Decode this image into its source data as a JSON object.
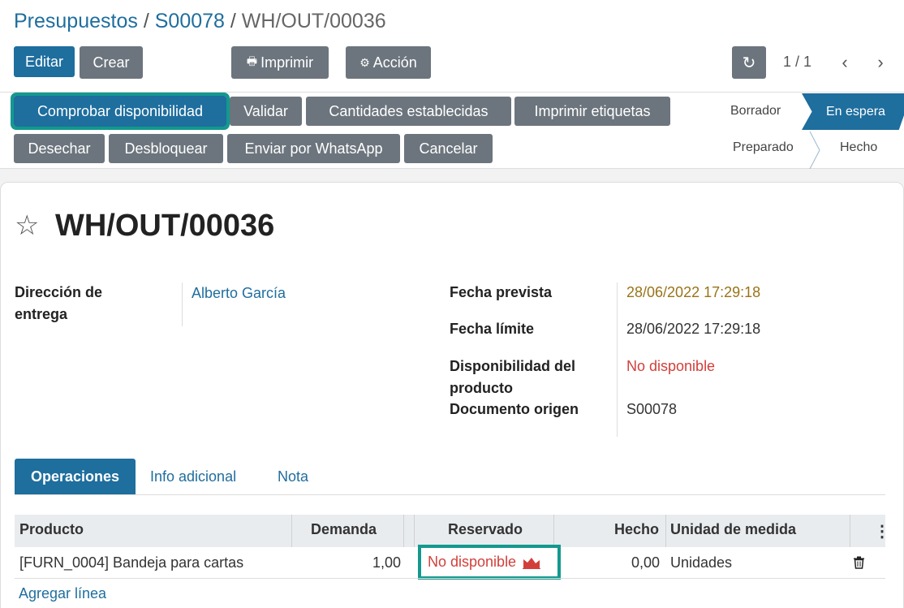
{
  "breadcrumb": {
    "crumb1": "Presupuestos",
    "sep1": "/",
    "crumb2": "S00078",
    "sep2": "/",
    "current": "WH/OUT/00036"
  },
  "toolbar": {
    "edit": "Editar",
    "create": "Crear",
    "print": "Imprimir",
    "action": "Acción"
  },
  "pager": {
    "value": "1 / 1"
  },
  "header_buttons": {
    "check_availability": "Comprobar disponibilidad",
    "validate": "Validar",
    "set_quantities": "Cantidades establecidas",
    "print_labels": "Imprimir etiquetas",
    "scrap": "Desechar",
    "unlock": "Desbloquear",
    "whatsapp": "Enviar por WhatsApp",
    "cancel": "Cancelar"
  },
  "statusbar": {
    "draft": "Borrador",
    "waiting": "En espera",
    "ready": "Preparado",
    "done": "Hecho",
    "active": "En espera"
  },
  "record": {
    "title": "WH/OUT/00036",
    "delivery_address_label_1": "Dirección de",
    "delivery_address_label_2": "entrega",
    "delivery_address": "Alberto García",
    "scheduled_date_label": "Fecha prevista",
    "scheduled_date": "28/06/2022 17:29:18",
    "deadline_label": "Fecha límite",
    "deadline": "28/06/2022 17:29:18",
    "availability_label_1": "Disponibilidad del",
    "availability_label_2": "producto",
    "availability": "No disponible",
    "origin_label": "Documento origen",
    "origin": "S00078"
  },
  "tabs": {
    "operations": "Operaciones",
    "extra_info": "Info adicional",
    "note": "Nota"
  },
  "table": {
    "headers": {
      "product": "Producto",
      "demand": "Demanda",
      "reserved": "Reservado",
      "done": "Hecho",
      "uom": "Unidad de medida"
    },
    "rows": [
      {
        "product": "[FURN_0004] Bandeja para cartas",
        "demand": "1,00",
        "reserved": "No disponible",
        "done": "0,00",
        "uom": "Unidades"
      }
    ],
    "add_line": "Agregar línea"
  },
  "colors": {
    "primary": "#1e6e9e",
    "secondary": "#6c757d",
    "highlight": "#13998e",
    "danger": "#d23f3a",
    "warning_date": "#9a7318"
  }
}
